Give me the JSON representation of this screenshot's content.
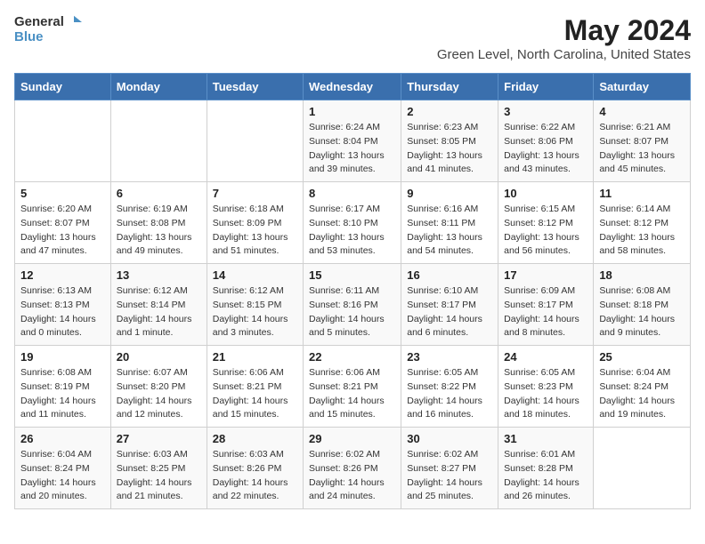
{
  "logo": {
    "text_general": "General",
    "text_blue": "Blue"
  },
  "title": "May 2024",
  "subtitle": "Green Level, North Carolina, United States",
  "weekdays": [
    "Sunday",
    "Monday",
    "Tuesday",
    "Wednesday",
    "Thursday",
    "Friday",
    "Saturday"
  ],
  "weeks": [
    [
      {
        "day": "",
        "info": ""
      },
      {
        "day": "",
        "info": ""
      },
      {
        "day": "",
        "info": ""
      },
      {
        "day": "1",
        "info": "Sunrise: 6:24 AM\nSunset: 8:04 PM\nDaylight: 13 hours and 39 minutes."
      },
      {
        "day": "2",
        "info": "Sunrise: 6:23 AM\nSunset: 8:05 PM\nDaylight: 13 hours and 41 minutes."
      },
      {
        "day": "3",
        "info": "Sunrise: 6:22 AM\nSunset: 8:06 PM\nDaylight: 13 hours and 43 minutes."
      },
      {
        "day": "4",
        "info": "Sunrise: 6:21 AM\nSunset: 8:07 PM\nDaylight: 13 hours and 45 minutes."
      }
    ],
    [
      {
        "day": "5",
        "info": "Sunrise: 6:20 AM\nSunset: 8:07 PM\nDaylight: 13 hours and 47 minutes."
      },
      {
        "day": "6",
        "info": "Sunrise: 6:19 AM\nSunset: 8:08 PM\nDaylight: 13 hours and 49 minutes."
      },
      {
        "day": "7",
        "info": "Sunrise: 6:18 AM\nSunset: 8:09 PM\nDaylight: 13 hours and 51 minutes."
      },
      {
        "day": "8",
        "info": "Sunrise: 6:17 AM\nSunset: 8:10 PM\nDaylight: 13 hours and 53 minutes."
      },
      {
        "day": "9",
        "info": "Sunrise: 6:16 AM\nSunset: 8:11 PM\nDaylight: 13 hours and 54 minutes."
      },
      {
        "day": "10",
        "info": "Sunrise: 6:15 AM\nSunset: 8:12 PM\nDaylight: 13 hours and 56 minutes."
      },
      {
        "day": "11",
        "info": "Sunrise: 6:14 AM\nSunset: 8:12 PM\nDaylight: 13 hours and 58 minutes."
      }
    ],
    [
      {
        "day": "12",
        "info": "Sunrise: 6:13 AM\nSunset: 8:13 PM\nDaylight: 14 hours and 0 minutes."
      },
      {
        "day": "13",
        "info": "Sunrise: 6:12 AM\nSunset: 8:14 PM\nDaylight: 14 hours and 1 minute."
      },
      {
        "day": "14",
        "info": "Sunrise: 6:12 AM\nSunset: 8:15 PM\nDaylight: 14 hours and 3 minutes."
      },
      {
        "day": "15",
        "info": "Sunrise: 6:11 AM\nSunset: 8:16 PM\nDaylight: 14 hours and 5 minutes."
      },
      {
        "day": "16",
        "info": "Sunrise: 6:10 AM\nSunset: 8:17 PM\nDaylight: 14 hours and 6 minutes."
      },
      {
        "day": "17",
        "info": "Sunrise: 6:09 AM\nSunset: 8:17 PM\nDaylight: 14 hours and 8 minutes."
      },
      {
        "day": "18",
        "info": "Sunrise: 6:08 AM\nSunset: 8:18 PM\nDaylight: 14 hours and 9 minutes."
      }
    ],
    [
      {
        "day": "19",
        "info": "Sunrise: 6:08 AM\nSunset: 8:19 PM\nDaylight: 14 hours and 11 minutes."
      },
      {
        "day": "20",
        "info": "Sunrise: 6:07 AM\nSunset: 8:20 PM\nDaylight: 14 hours and 12 minutes."
      },
      {
        "day": "21",
        "info": "Sunrise: 6:06 AM\nSunset: 8:21 PM\nDaylight: 14 hours and 15 minutes."
      },
      {
        "day": "22",
        "info": "Sunrise: 6:06 AM\nSunset: 8:21 PM\nDaylight: 14 hours and 15 minutes."
      },
      {
        "day": "23",
        "info": "Sunrise: 6:05 AM\nSunset: 8:22 PM\nDaylight: 14 hours and 16 minutes."
      },
      {
        "day": "24",
        "info": "Sunrise: 6:05 AM\nSunset: 8:23 PM\nDaylight: 14 hours and 18 minutes."
      },
      {
        "day": "25",
        "info": "Sunrise: 6:04 AM\nSunset: 8:24 PM\nDaylight: 14 hours and 19 minutes."
      }
    ],
    [
      {
        "day": "26",
        "info": "Sunrise: 6:04 AM\nSunset: 8:24 PM\nDaylight: 14 hours and 20 minutes."
      },
      {
        "day": "27",
        "info": "Sunrise: 6:03 AM\nSunset: 8:25 PM\nDaylight: 14 hours and 21 minutes."
      },
      {
        "day": "28",
        "info": "Sunrise: 6:03 AM\nSunset: 8:26 PM\nDaylight: 14 hours and 22 minutes."
      },
      {
        "day": "29",
        "info": "Sunrise: 6:02 AM\nSunset: 8:26 PM\nDaylight: 14 hours and 24 minutes."
      },
      {
        "day": "30",
        "info": "Sunrise: 6:02 AM\nSunset: 8:27 PM\nDaylight: 14 hours and 25 minutes."
      },
      {
        "day": "31",
        "info": "Sunrise: 6:01 AM\nSunset: 8:28 PM\nDaylight: 14 hours and 26 minutes."
      },
      {
        "day": "",
        "info": ""
      }
    ]
  ]
}
